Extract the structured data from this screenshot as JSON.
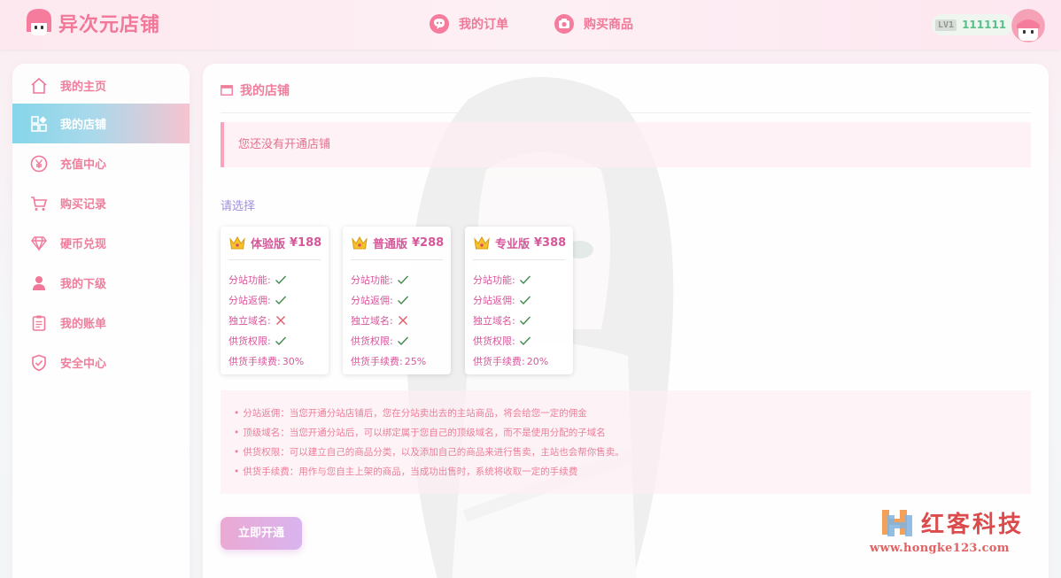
{
  "app": {
    "title": "异次元店铺"
  },
  "header": {
    "nav": [
      {
        "label": "我的订单",
        "icon": "chat-bubble-icon"
      },
      {
        "label": "购买商品",
        "icon": "camera-icon"
      }
    ],
    "user": {
      "level": "LV1",
      "name": "111111"
    }
  },
  "sidebar": {
    "items": [
      {
        "label": "我的主页",
        "icon": "home-icon"
      },
      {
        "label": "我的店铺",
        "icon": "apps-icon",
        "active": true
      },
      {
        "label": "充值中心",
        "icon": "yen-icon"
      },
      {
        "label": "购买记录",
        "icon": "cart-icon"
      },
      {
        "label": "硬币兑现",
        "icon": "diamond-icon"
      },
      {
        "label": "我的下级",
        "icon": "user-icon"
      },
      {
        "label": "我的账单",
        "icon": "clipboard-icon"
      },
      {
        "label": "安全中心",
        "icon": "shield-icon"
      }
    ]
  },
  "main": {
    "title": "我的店铺",
    "notice": "您还没有开通店铺",
    "choose_label": "请选择",
    "plans": [
      {
        "name": "体验版",
        "price": "¥188",
        "features": [
          {
            "label": "分站功能:",
            "ok": true
          },
          {
            "label": "分站返佣:",
            "ok": true
          },
          {
            "label": "独立域名:",
            "ok": false
          },
          {
            "label": "供货权限:",
            "ok": true
          }
        ],
        "fee_label": "供货手续费:",
        "fee": "30%"
      },
      {
        "name": "普通版",
        "price": "¥288",
        "features": [
          {
            "label": "分站功能:",
            "ok": true
          },
          {
            "label": "分站返佣:",
            "ok": true
          },
          {
            "label": "独立域名:",
            "ok": false
          },
          {
            "label": "供货权限:",
            "ok": true
          }
        ],
        "fee_label": "供货手续费:",
        "fee": "25%"
      },
      {
        "name": "专业版",
        "price": "¥388",
        "features": [
          {
            "label": "分站功能:",
            "ok": true
          },
          {
            "label": "分站返佣:",
            "ok": true
          },
          {
            "label": "独立域名:",
            "ok": true
          },
          {
            "label": "供货权限:",
            "ok": true
          }
        ],
        "fee_label": "供货手续费:",
        "fee": "20%"
      }
    ],
    "descriptions": [
      "分站返佣：当您开通分站店铺后，您在分站卖出去的主站商品，将会给您一定的佣金",
      "顶级域名：当您开通分站后，可以绑定属于您自己的顶级域名，而不是使用分配的子域名",
      "供货权限：可以建立自己的商品分类，以及添加自己的商品来进行售卖，主站也会帮你售卖。",
      "供货手续费：用作与您自主上架的商品，当成功出售时，系统将收取一定的手续费"
    ],
    "open_button": "立即开通"
  },
  "watermark": {
    "title": "红客科技",
    "url": "www.hongke123.com"
  },
  "colors": {
    "accent": "#ef7e9c",
    "plan_text": "#d6579a",
    "check": "#3f8a4b",
    "cross": "#e05a6a"
  }
}
